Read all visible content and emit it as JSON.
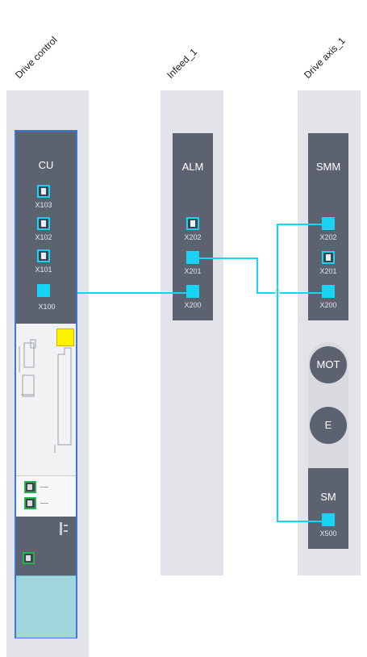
{
  "columns": {
    "drive_control": {
      "label": "Drive control",
      "cu": {
        "title": "CU",
        "ports": [
          {
            "name": "X103"
          },
          {
            "name": "X102"
          },
          {
            "name": "X101"
          },
          {
            "name": "X100"
          }
        ]
      }
    },
    "infeed": {
      "label": "Infeed_1",
      "alm": {
        "title": "ALM",
        "ports": [
          {
            "name": "X202"
          },
          {
            "name": "X201"
          },
          {
            "name": "X200"
          }
        ]
      }
    },
    "drive_axis": {
      "label": "Drive axis_1",
      "smm": {
        "title": "SMM",
        "ports": [
          {
            "name": "X202"
          },
          {
            "name": "X201"
          },
          {
            "name": "X200"
          }
        ]
      },
      "motor": {
        "mot_label": "MOT",
        "encoder_label": "E"
      },
      "sm": {
        "title": "SM",
        "port": "X500"
      }
    }
  },
  "colors": {
    "drive_cliq_cable": "#19d3f5",
    "module_body": "#5d6270",
    "lane_background": "#e3e4ea",
    "active_port_border": "#23b34a",
    "status_led": "#fff200"
  }
}
